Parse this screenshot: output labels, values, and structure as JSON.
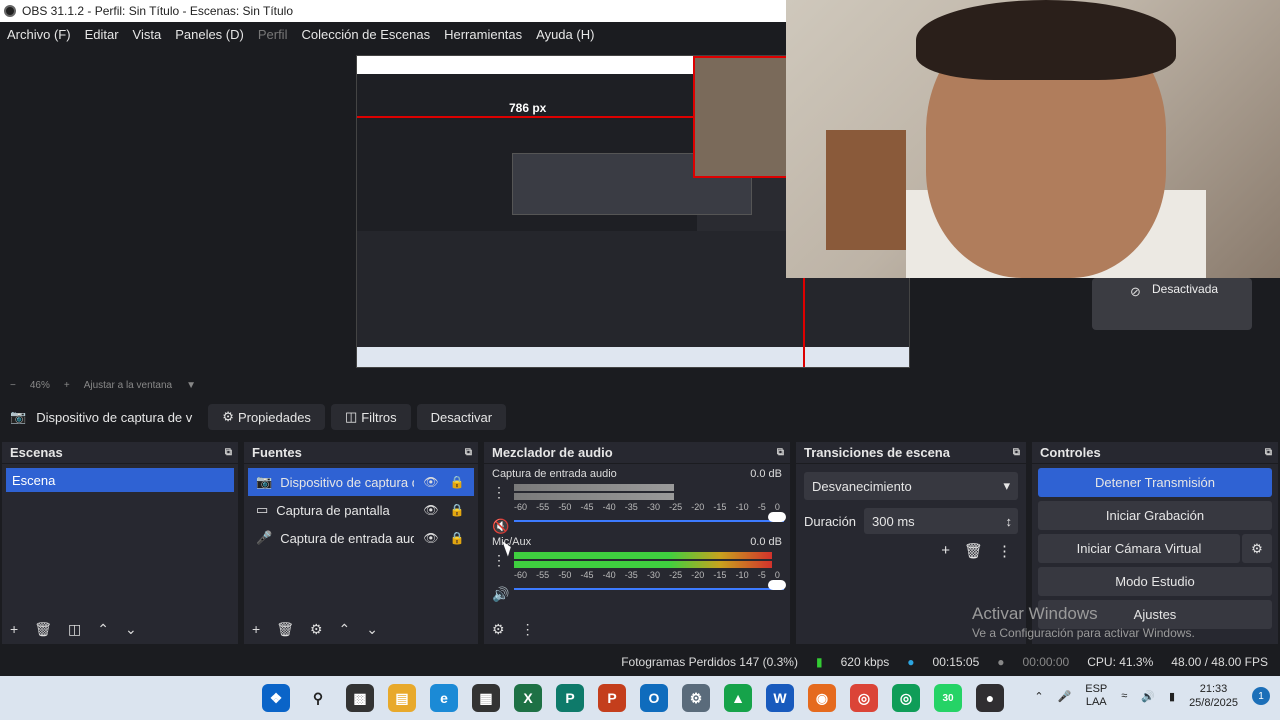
{
  "window": {
    "title": "OBS 31.1.2 - Perfil: Sin Título - Escenas: Sin Título"
  },
  "menu": [
    {
      "label": "Archivo (F)"
    },
    {
      "label": "Editar"
    },
    {
      "label": "Vista"
    },
    {
      "label": "Paneles (D)"
    },
    {
      "label": "Perfil",
      "disabled": true
    },
    {
      "label": "Colección de Escenas"
    },
    {
      "label": "Herramientas"
    },
    {
      "label": "Ayuda (H)"
    }
  ],
  "preview": {
    "measure_label": "786 px",
    "webcam_badge": "Desactivada"
  },
  "zoom": {
    "minus": "−",
    "percent": "46%",
    "plus": "+",
    "fit": "Ajustar a la ventana"
  },
  "source_toolbar": {
    "source_name": "Dispositivo de captura de v",
    "properties": "Propiedades",
    "filters": "Filtros",
    "deactivate": "Desactivar"
  },
  "scenes": {
    "title": "Escenas",
    "items": [
      {
        "label": "Escena"
      }
    ]
  },
  "sources": {
    "title": "Fuentes",
    "items": [
      {
        "label": "Dispositivo de captura de v",
        "icon": "camera-icon",
        "selected": true
      },
      {
        "label": "Captura de pantalla",
        "icon": "monitor-icon"
      },
      {
        "label": "Captura de entrada audio",
        "icon": "microphone-icon"
      }
    ]
  },
  "mixer": {
    "title": "Mezclador de audio",
    "ticks": [
      "-60",
      "-55",
      "-50",
      "-45",
      "-40",
      "-35",
      "-30",
      "-25",
      "-20",
      "-15",
      "-10",
      "-5",
      "0"
    ],
    "channels": [
      {
        "name": "Captura de entrada audio",
        "db": "0.0 dB",
        "level": 0.6,
        "muted": true
      },
      {
        "name": "Mic/Aux",
        "db": "0.0 dB",
        "level": 0.97,
        "muted": false
      }
    ]
  },
  "transitions": {
    "title": "Transiciones de escena",
    "selected": "Desvanecimiento",
    "duration_label": "Duración",
    "duration_value": "300 ms"
  },
  "controls": {
    "title": "Controles",
    "stop_stream": "Detener Transmisión",
    "start_record": "Iniciar Grabación",
    "virtual_cam": "Iniciar Cámara Virtual",
    "studio_mode": "Modo Estudio",
    "settings": "Ajustes"
  },
  "watermark": {
    "line1": "Activar Windows",
    "line2": "Ve a Configuración para activar Windows."
  },
  "status": {
    "dropped": "Fotogramas Perdidos 147 (0.3%)",
    "bitrate": "620 kbps",
    "stream_time": "00:15:05",
    "rec_time": "00:00:00",
    "cpu": "CPU: 41.3%",
    "fps": "48.00 / 48.00 FPS"
  },
  "taskbar": {
    "lang": "ESP",
    "lang2": "LAA",
    "time": "21:33",
    "date": "25/8/2025",
    "notif": "1",
    "badge30": "30"
  },
  "colors": {
    "accent": "#2f62d3",
    "dock": "#272830",
    "bg": "#1b1c20"
  }
}
